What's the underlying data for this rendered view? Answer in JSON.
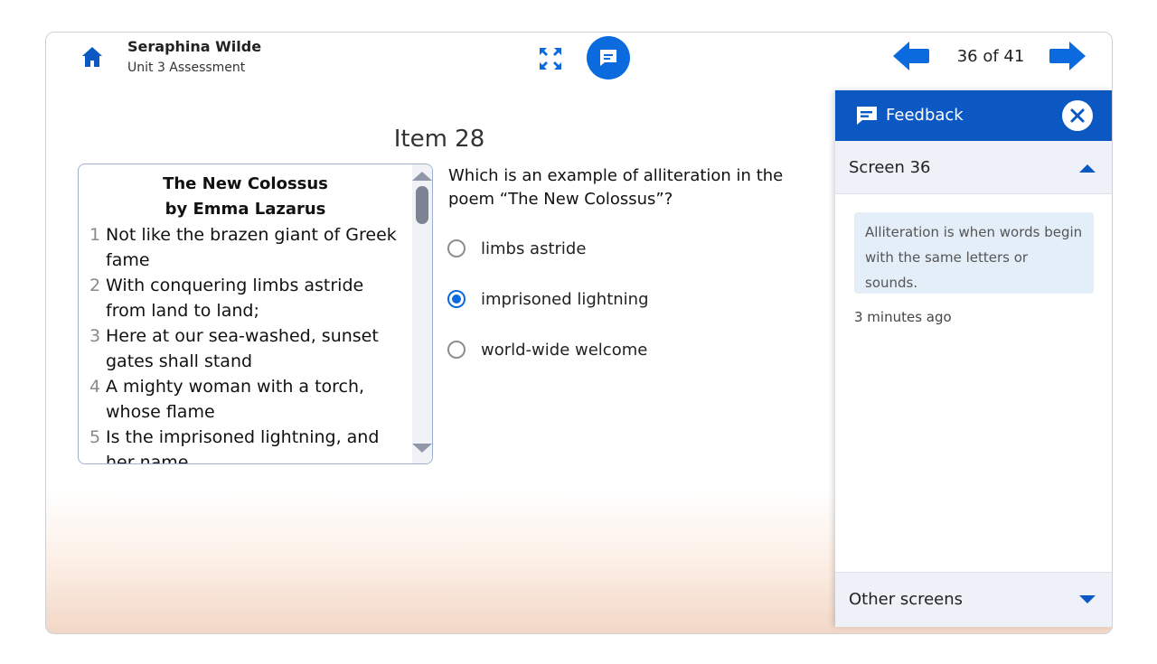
{
  "header": {
    "user_name": "Seraphina Wilde",
    "assessment_name": "Unit 3 Assessment",
    "page_counter": "36 of 41",
    "icons": [
      "home-icon",
      "expand-icon",
      "feedback-icon",
      "prev-arrow-icon",
      "next-arrow-icon"
    ]
  },
  "item": {
    "title": "Item 28",
    "passage": {
      "title_line1": "The New Colossus",
      "title_line2": "by Emma Lazarus",
      "lines": [
        {
          "num": "1",
          "text": "Not like the brazen giant of Greek fame"
        },
        {
          "num": "2",
          "text": "With conquering limbs astride from land to land;"
        },
        {
          "num": "3",
          "text": "Here at our sea-washed, sunset gates shall stand"
        },
        {
          "num": "4",
          "text": "A mighty woman with a torch, whose flame"
        },
        {
          "num": "5",
          "text": "Is the imprisoned lightning, and her name"
        }
      ]
    },
    "question": "Which is an example of alliteration in the poem “The New Colossus”?",
    "options": [
      {
        "label": "limbs astride",
        "selected": false
      },
      {
        "label": "imprisoned lightning",
        "selected": true
      },
      {
        "label": "world-wide welcome",
        "selected": false
      }
    ]
  },
  "feedback_panel": {
    "title": "Feedback",
    "screen_label": "Screen 36",
    "comment": "Alliteration is when words begin with the same letters or sounds.",
    "timestamp": "3 minutes ago",
    "other_screens_label": "Other screens"
  },
  "colors": {
    "accent": "#0b6bde",
    "panel_header": "#0b58c3",
    "comment_bg": "#e3eef9"
  }
}
